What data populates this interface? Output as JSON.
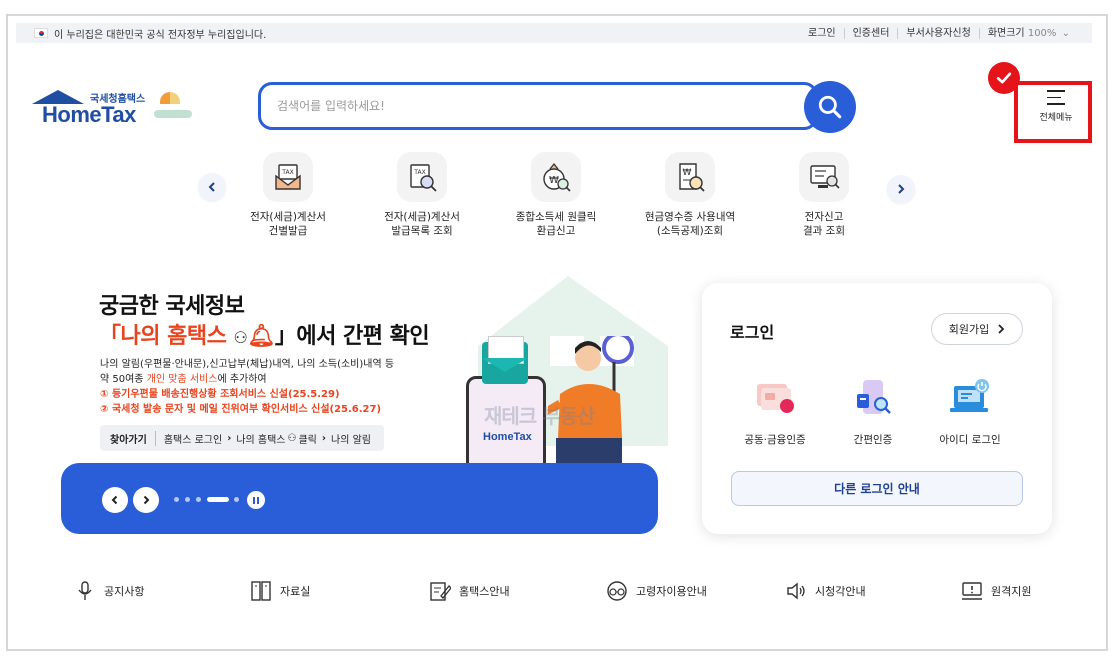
{
  "gov_bar": {
    "notice": "이 누리집은 대한민국 공식 전자정부 누리집입니다.",
    "links": [
      "로그인",
      "인증센터",
      "부서사용자신청"
    ],
    "zoom_label": "화면크기",
    "zoom_value": "100%"
  },
  "logo": {
    "sub": "국세청홈택스",
    "brand": "HomeTax"
  },
  "search": {
    "placeholder": "검색어를 입력하세요!"
  },
  "menu": {
    "full_menu_label": "전체메뉴"
  },
  "quick_menu": [
    {
      "line1": "전자(세금)계산서",
      "line2": "건별발급",
      "icon": "invoice-issue-icon"
    },
    {
      "line1": "전자(세금)계산서",
      "line2": "발급목록 조회",
      "icon": "tax-invoice-search-icon"
    },
    {
      "line1": "종합소득세 원클릭",
      "line2": "환급신고",
      "icon": "income-tax-refund-icon"
    },
    {
      "line1": "현금영수증 사용내역",
      "line2": "(소득공제)조회",
      "icon": "cash-receipt-search-icon"
    },
    {
      "line1": "전자신고",
      "line2": "결과 조회",
      "icon": "e-filing-result-icon"
    }
  ],
  "banner": {
    "title_line1": "궁금한 국세정보",
    "title_line2_pre": "「나의 홈택스",
    "title_line2_post": "」에서 간편 확인",
    "desc_line1": "나의 알림(우편물·안내문),신고납부(체납)내역, 나의 소득(소비)내역 등",
    "desc_line2_pre": "약 50여종 ",
    "desc_line2_red": "개인 맞춤 서비스",
    "desc_line2_post": "에 추가하여",
    "note1": "① 등기우편물 배송진행상황 조회서비스 신설(25.5.29)",
    "note2": "② 국세청 발송 문자 및 메일 진위여부 확인서비스 신설(25.6.27)",
    "path_label": "찾아가기",
    "path_steps": [
      "홈택스 로그인",
      "나의 홈택스",
      "클릭",
      "나의 알림"
    ],
    "watermark": "재테크 부동산",
    "phone_logo": "HomeTax"
  },
  "login": {
    "title": "로그인",
    "join_label": "회원가입",
    "options": [
      {
        "label": "공동·금융인증",
        "icon": "certificate-icon"
      },
      {
        "label": "간편인증",
        "icon": "simple-auth-icon"
      },
      {
        "label": "아이디 로그인",
        "icon": "id-login-icon"
      }
    ],
    "other_label": "다른 로그인 안내"
  },
  "bottom_links": [
    {
      "label": "공지사항",
      "icon": "microphone-icon"
    },
    {
      "label": "자료실",
      "icon": "archive-icon"
    },
    {
      "label": "홈택스안내",
      "icon": "guide-icon"
    },
    {
      "label": "고령자이용안내",
      "icon": "senior-icon"
    },
    {
      "label": "시청각안내",
      "icon": "speaker-icon"
    },
    {
      "label": "원격지원",
      "icon": "remote-support-icon"
    }
  ],
  "colors": {
    "primary": "#2a5ed8",
    "highlight": "#e5141b",
    "accent_orange": "#e8441f"
  }
}
